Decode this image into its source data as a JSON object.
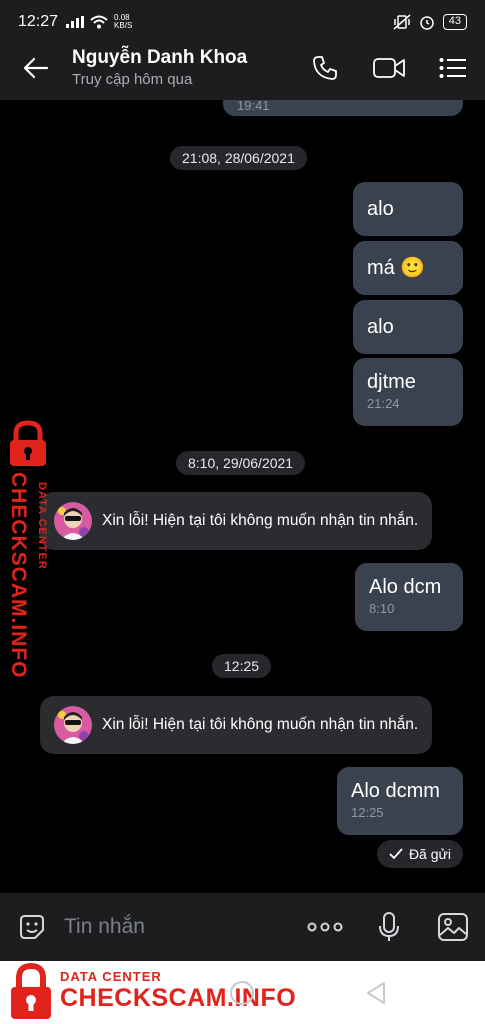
{
  "status_bar": {
    "time": "12:27",
    "net_speed": "0.08",
    "net_unit": "KB/S",
    "battery": "43"
  },
  "header": {
    "name": "Nguyễn Danh Khoa",
    "status": "Truy cập hôm qua"
  },
  "chat": {
    "top_partial_time": "19:41",
    "date1": "21:08, 28/06/2021",
    "out1": "alo",
    "out2": "má 🙂",
    "out3": "alo",
    "out4": {
      "text": "djtme",
      "time": "21:24"
    },
    "date2": "8:10, 29/06/2021",
    "in1": "Xin lỗi! Hiện tại tôi không muốn nhận tin nhắn.",
    "out5": {
      "text": "Alo dcm",
      "time": "8:10"
    },
    "date3": "12:25",
    "in2": "Xin lỗi! Hiện tại tôi không muốn nhận tin nhắn.",
    "out6": {
      "text": "Alo dcmm",
      "time": "12:25"
    },
    "sent_status": "Đã gửi"
  },
  "composer": {
    "placeholder": "Tin nhắn"
  },
  "watermark": {
    "small": "DATA CENTER",
    "big": "CHECKSCAM.INFO"
  },
  "colors": {
    "accent_red": "#e0231b",
    "outgoing_bubble": "#3a4250",
    "incoming_bubble": "#2a2c30"
  }
}
